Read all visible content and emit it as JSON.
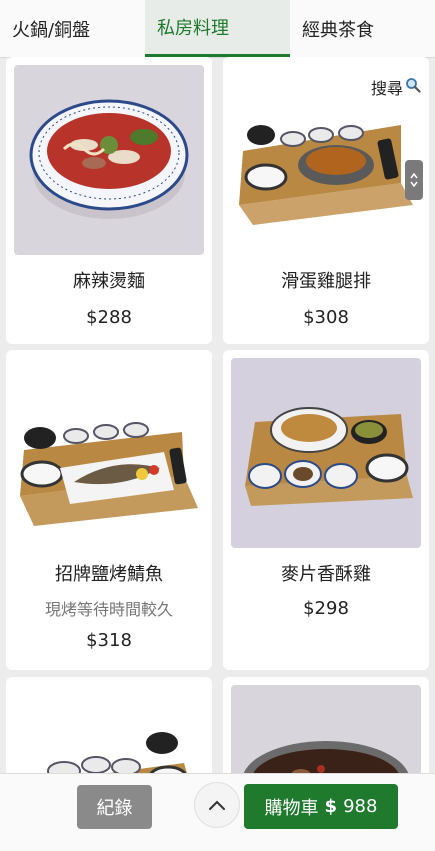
{
  "tabs": [
    {
      "label": "火鍋/銅盤"
    },
    {
      "label": "私房料理"
    },
    {
      "label": "經典茶食"
    }
  ],
  "active_tab_index": 1,
  "search": {
    "label": "搜尋",
    "icon": "magnifier-icon"
  },
  "menu_items": [
    {
      "name": "麻辣燙麵",
      "price": "$288",
      "note": ""
    },
    {
      "name": "滑蛋雞腿排",
      "price": "$308",
      "note": ""
    },
    {
      "name": "招牌鹽烤鯖魚",
      "price": "$318",
      "note": "現烤等待時間較久"
    },
    {
      "name": "麥片香酥雞",
      "price": "$298",
      "note": ""
    }
  ],
  "bottom": {
    "record_label": "紀錄",
    "cart_label": "購物車",
    "cart_currency_icon": "dollar-icon",
    "cart_total": "988"
  },
  "colors": {
    "accent": "#1f7a2e",
    "record_button": "#8a8a8a"
  }
}
